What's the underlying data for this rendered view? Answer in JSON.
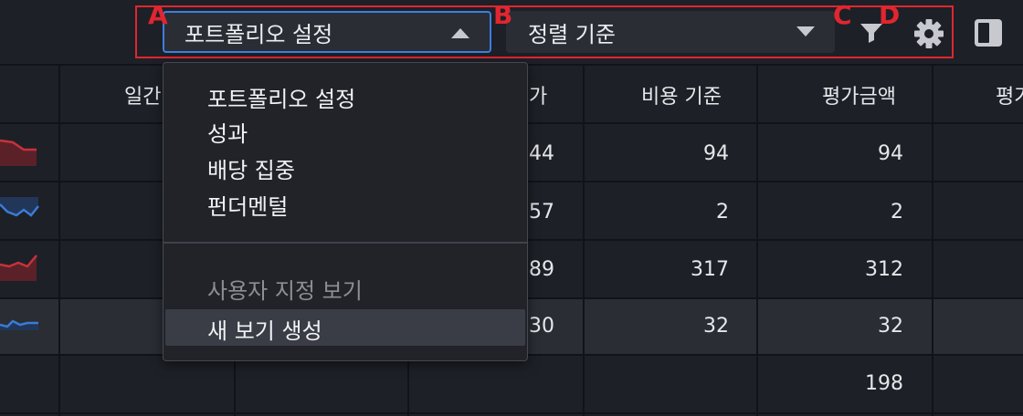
{
  "toolbar": {
    "portfolio_select": "포트폴리오 설정",
    "sort_select": "정렬 기준",
    "filter_icon": "filter-icon",
    "settings_icon": "gear-icon",
    "panel_icon": "sidebar-panel-icon"
  },
  "markers": {
    "a": "A",
    "b": "B",
    "c": "C",
    "d": "D"
  },
  "colors": {
    "accent": "#3b7fe0",
    "annotation": "#e0262f",
    "spark_red": "#c8323a",
    "spark_blue": "#3a7bd5"
  },
  "table": {
    "headers": [
      "일간",
      "가",
      "비용 기준",
      "평가금액",
      "평가"
    ],
    "rows": [
      {
        "sparkline": "red",
        "price": "44",
        "cost_basis": "94",
        "value": "94"
      },
      {
        "sparkline": "blue",
        "price": "57",
        "cost_basis": "2",
        "value": "2"
      },
      {
        "sparkline": "red",
        "price": "89",
        "cost_basis": "317",
        "value": "312"
      },
      {
        "sparkline": "blue",
        "price": "30",
        "cost_basis": "32",
        "value": "32"
      },
      {
        "sparkline": "",
        "price": "",
        "cost_basis": "",
        "value": "198"
      }
    ]
  },
  "menu": {
    "items": [
      "포트폴리오 설정",
      "성과",
      "배당 집중",
      "펀더멘털"
    ],
    "custom_header": "사용자 지정 보기",
    "create_view": "새 보기 생성"
  }
}
